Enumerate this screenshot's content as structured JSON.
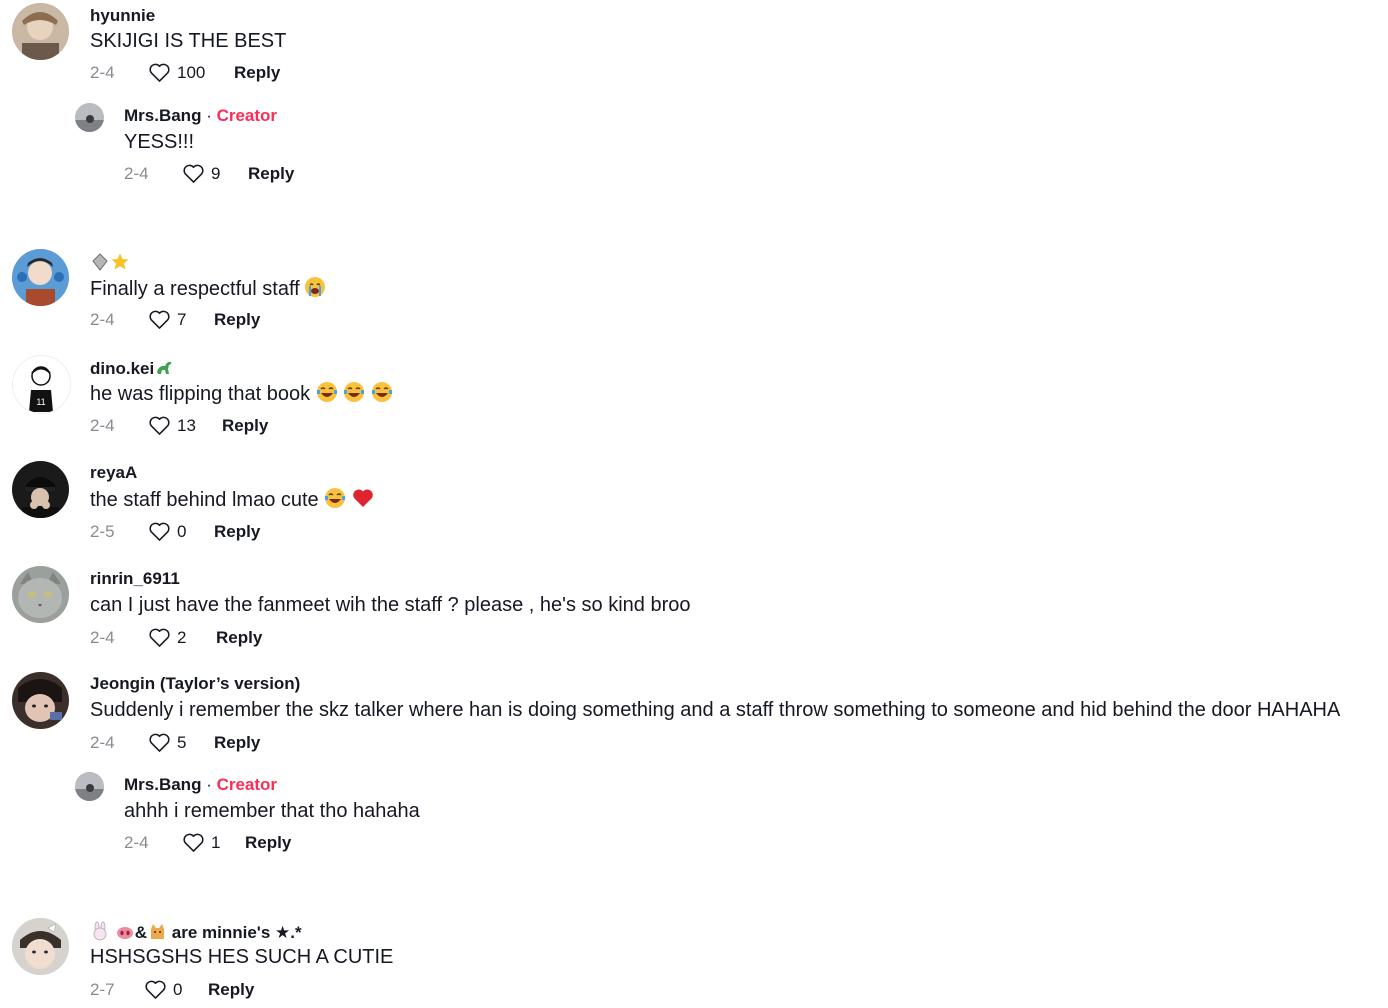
{
  "comments": [
    {
      "username": "hyunnie",
      "text": "SKIJIGI IS THE BEST",
      "date": "2-4",
      "likes": "100",
      "reply": "Reply"
    },
    {
      "username": "Mrs.Bang",
      "sep": " · ",
      "creator": "Creator",
      "text": "YESS!!!",
      "date": "2-4",
      "likes": "9",
      "reply": "Reply"
    },
    {
      "username": "",
      "text": "Finally a respectful staff",
      "date": "2-4",
      "likes": "7",
      "reply": "Reply"
    },
    {
      "username": "dino.kei",
      "text": "he was flipping that book",
      "date": "2-4",
      "likes": "13",
      "reply": "Reply"
    },
    {
      "username": "reyaA",
      "text": "the staff behind lmao cute",
      "date": "2-5",
      "likes": "0",
      "reply": "Reply"
    },
    {
      "username": "rinrin_6911",
      "text": "can I just have the fanmeet wih the staff ? please , he's so kind broo",
      "date": "2-4",
      "likes": "2",
      "reply": "Reply"
    },
    {
      "username": "Jeongin (Taylor’s version)",
      "text": "Suddenly i remember the skz talker where han is doing something and a staff throw something to someone and hid behind the door HAHAHA",
      "date": "2-4",
      "likes": "5",
      "reply": "Reply"
    },
    {
      "username": "Mrs.Bang",
      "sep": " · ",
      "creator": "Creator",
      "text": "ahhh i remember that tho hahaha",
      "date": "2-4",
      "likes": "1",
      "reply": "Reply"
    },
    {
      "username_prefix": "&",
      "username": "are minnie's ★.*",
      "text": "HSHSGSHS HES SUCH A CUTIE",
      "date": "2-7",
      "likes": "0",
      "reply": "Reply"
    }
  ],
  "colors": {
    "creator": "#fe2c55",
    "date": "#8a8b91",
    "text": "#161823"
  },
  "icons": [
    "heart-outline-icon",
    "gem-icon",
    "star-icon",
    "crying-face-icon",
    "laughing-face-icon",
    "red-heart-icon",
    "dinosaur-icon",
    "bunny-icon",
    "pig-nose-icon",
    "cat-icon"
  ]
}
